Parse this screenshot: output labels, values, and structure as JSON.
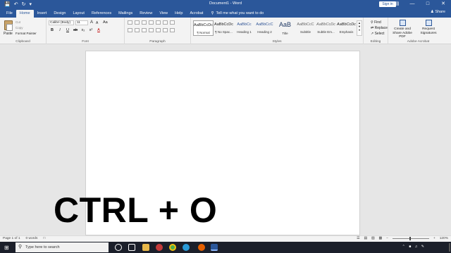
{
  "window": {
    "title": "Document1  -  Word",
    "sign_in": "Sign in",
    "quick_access": [
      "save-icon",
      "undo-icon",
      "redo-icon",
      "customize-icon"
    ],
    "controls": [
      "restore-ribbon-icon",
      "minimize-icon",
      "maximize-icon",
      "close-icon"
    ]
  },
  "tabs": [
    "File",
    "Home",
    "Insert",
    "Design",
    "Layout",
    "References",
    "Mailings",
    "Review",
    "View",
    "Help",
    "Acrobat"
  ],
  "active_tab": "Home",
  "tell_me": "Tell me what you want to do",
  "share": "Share",
  "ribbon": {
    "clipboard": {
      "paste": "Paste",
      "cut": "Cut",
      "copy": "Copy",
      "format_painter": "Format Painter",
      "label": "Clipboard"
    },
    "font": {
      "family": "Calibri (Body)",
      "size": "11",
      "grow": "A",
      "shrink": "A",
      "case": "Aa",
      "bold": "B",
      "italic": "I",
      "underline": "U",
      "strike": "ab",
      "subscript": "x₂",
      "superscript": "x²",
      "label": "Font"
    },
    "paragraph": {
      "label": "Paragraph"
    },
    "styles": {
      "label": "Styles",
      "items": [
        {
          "sample": "AaBbCcDc",
          "name": "¶ Normal"
        },
        {
          "sample": "AaBbCcDc",
          "name": "¶ No Spac..."
        },
        {
          "sample": "AaBbCc",
          "name": "Heading 1"
        },
        {
          "sample": "AaBbCcC",
          "name": "Heading 2"
        },
        {
          "sample": "AaB",
          "name": "Title"
        },
        {
          "sample": "AaBbCcC",
          "name": "Subtitle"
        },
        {
          "sample": "AaBbCcDc",
          "name": "Subtle Em..."
        },
        {
          "sample": "AaBbCcDc",
          "name": "Emphasis"
        }
      ]
    },
    "editing": {
      "find": "Find",
      "replace": "Replace",
      "select": "Select",
      "label": "Editing"
    },
    "acrobat": {
      "create": "Create and Share Adobe PDF",
      "request": "Request Signatures",
      "label": "Adobe Acrobat"
    }
  },
  "status": {
    "page": "Page 1 of 1",
    "words": "0 words",
    "zoom": "120%"
  },
  "taskbar": {
    "search_placeholder": "Type here to search"
  },
  "overlay_caption": "CTRL + O"
}
